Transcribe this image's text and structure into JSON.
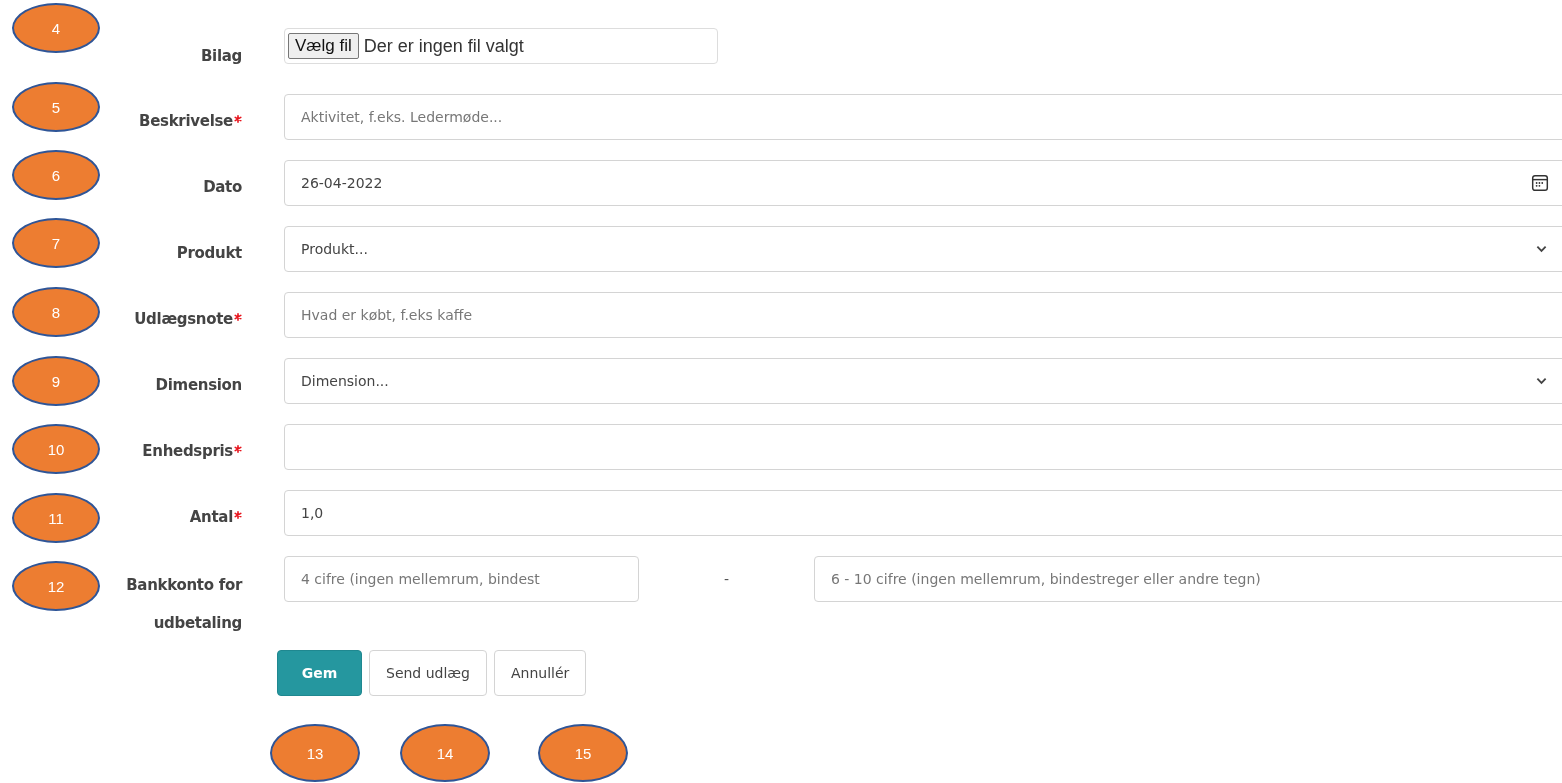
{
  "fields": [
    {
      "kind": "file",
      "label": "Bilag",
      "required": false,
      "button": "Vælg fil",
      "status": "Der er ingen fil valgt"
    },
    {
      "kind": "text",
      "label": "Beskrivelse",
      "required": true,
      "placeholder": "Aktivitet, f.eks. Ledermøde..."
    },
    {
      "kind": "date",
      "label": "Dato",
      "required": false,
      "value": "26-04-2022"
    },
    {
      "kind": "select",
      "label": "Produkt",
      "required": false,
      "value": "Produkt..."
    },
    {
      "kind": "text",
      "label": "Udlægsnote",
      "required": true,
      "placeholder": "Hvad er købt, f.eks kaffe"
    },
    {
      "kind": "select",
      "label": "Dimension",
      "required": false,
      "value": "Dimension..."
    },
    {
      "kind": "text",
      "label": "Enhedspris",
      "required": true
    },
    {
      "kind": "text",
      "label": "Antal",
      "required": true,
      "value": "1,0"
    },
    {
      "kind": "split",
      "label": "Bankkonto for udbetaling",
      "required": false,
      "placeholder": "4 cifre (ingen mellemrum, bindest",
      "separator": "-",
      "placeholder_2": "6 - 10 cifre (ingen mellemrum, bindestreger eller andre tegn)"
    }
  ],
  "buttons": [
    {
      "label": "Gem",
      "kind": "primary"
    },
    {
      "label": "Send udlæg",
      "kind": "default"
    },
    {
      "label": "Annullér",
      "kind": "default"
    }
  ],
  "side_callouts": [
    "4",
    "5",
    "6",
    "7",
    "8",
    "9",
    "10",
    "11",
    "12"
  ],
  "bottom_callouts": [
    "13",
    "14",
    "15"
  ]
}
